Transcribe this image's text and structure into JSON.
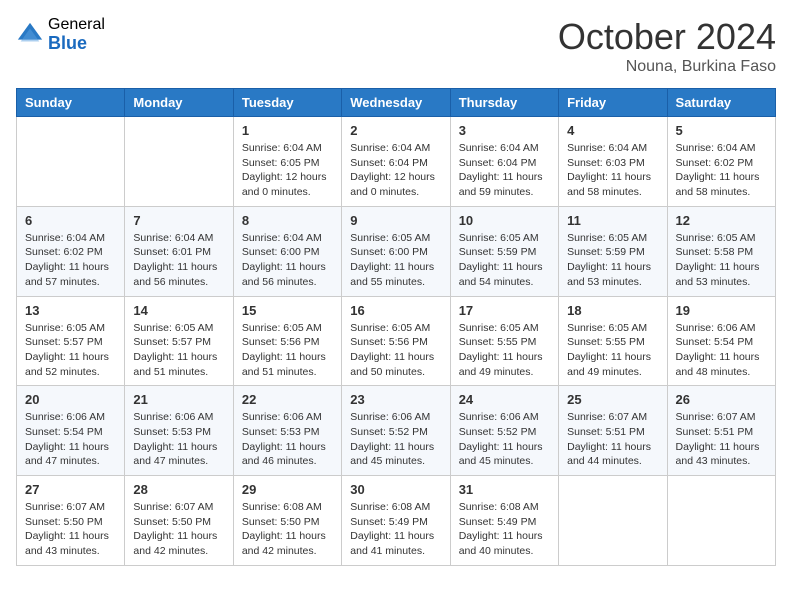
{
  "logo": {
    "general": "General",
    "blue": "Blue"
  },
  "title": "October 2024",
  "location": "Nouna, Burkina Faso",
  "days_of_week": [
    "Sunday",
    "Monday",
    "Tuesday",
    "Wednesday",
    "Thursday",
    "Friday",
    "Saturday"
  ],
  "weeks": [
    [
      null,
      null,
      {
        "day": "1",
        "sunrise": "6:04 AM",
        "sunset": "6:05 PM",
        "daylight": "12 hours and 0 minutes."
      },
      {
        "day": "2",
        "sunrise": "6:04 AM",
        "sunset": "6:04 PM",
        "daylight": "12 hours and 0 minutes."
      },
      {
        "day": "3",
        "sunrise": "6:04 AM",
        "sunset": "6:04 PM",
        "daylight": "11 hours and 59 minutes."
      },
      {
        "day": "4",
        "sunrise": "6:04 AM",
        "sunset": "6:03 PM",
        "daylight": "11 hours and 58 minutes."
      },
      {
        "day": "5",
        "sunrise": "6:04 AM",
        "sunset": "6:02 PM",
        "daylight": "11 hours and 58 minutes."
      }
    ],
    [
      {
        "day": "6",
        "sunrise": "6:04 AM",
        "sunset": "6:02 PM",
        "daylight": "11 hours and 57 minutes."
      },
      {
        "day": "7",
        "sunrise": "6:04 AM",
        "sunset": "6:01 PM",
        "daylight": "11 hours and 56 minutes."
      },
      {
        "day": "8",
        "sunrise": "6:04 AM",
        "sunset": "6:00 PM",
        "daylight": "11 hours and 56 minutes."
      },
      {
        "day": "9",
        "sunrise": "6:05 AM",
        "sunset": "6:00 PM",
        "daylight": "11 hours and 55 minutes."
      },
      {
        "day": "10",
        "sunrise": "6:05 AM",
        "sunset": "5:59 PM",
        "daylight": "11 hours and 54 minutes."
      },
      {
        "day": "11",
        "sunrise": "6:05 AM",
        "sunset": "5:59 PM",
        "daylight": "11 hours and 53 minutes."
      },
      {
        "day": "12",
        "sunrise": "6:05 AM",
        "sunset": "5:58 PM",
        "daylight": "11 hours and 53 minutes."
      }
    ],
    [
      {
        "day": "13",
        "sunrise": "6:05 AM",
        "sunset": "5:57 PM",
        "daylight": "11 hours and 52 minutes."
      },
      {
        "day": "14",
        "sunrise": "6:05 AM",
        "sunset": "5:57 PM",
        "daylight": "11 hours and 51 minutes."
      },
      {
        "day": "15",
        "sunrise": "6:05 AM",
        "sunset": "5:56 PM",
        "daylight": "11 hours and 51 minutes."
      },
      {
        "day": "16",
        "sunrise": "6:05 AM",
        "sunset": "5:56 PM",
        "daylight": "11 hours and 50 minutes."
      },
      {
        "day": "17",
        "sunrise": "6:05 AM",
        "sunset": "5:55 PM",
        "daylight": "11 hours and 49 minutes."
      },
      {
        "day": "18",
        "sunrise": "6:05 AM",
        "sunset": "5:55 PM",
        "daylight": "11 hours and 49 minutes."
      },
      {
        "day": "19",
        "sunrise": "6:06 AM",
        "sunset": "5:54 PM",
        "daylight": "11 hours and 48 minutes."
      }
    ],
    [
      {
        "day": "20",
        "sunrise": "6:06 AM",
        "sunset": "5:54 PM",
        "daylight": "11 hours and 47 minutes."
      },
      {
        "day": "21",
        "sunrise": "6:06 AM",
        "sunset": "5:53 PM",
        "daylight": "11 hours and 47 minutes."
      },
      {
        "day": "22",
        "sunrise": "6:06 AM",
        "sunset": "5:53 PM",
        "daylight": "11 hours and 46 minutes."
      },
      {
        "day": "23",
        "sunrise": "6:06 AM",
        "sunset": "5:52 PM",
        "daylight": "11 hours and 45 minutes."
      },
      {
        "day": "24",
        "sunrise": "6:06 AM",
        "sunset": "5:52 PM",
        "daylight": "11 hours and 45 minutes."
      },
      {
        "day": "25",
        "sunrise": "6:07 AM",
        "sunset": "5:51 PM",
        "daylight": "11 hours and 44 minutes."
      },
      {
        "day": "26",
        "sunrise": "6:07 AM",
        "sunset": "5:51 PM",
        "daylight": "11 hours and 43 minutes."
      }
    ],
    [
      {
        "day": "27",
        "sunrise": "6:07 AM",
        "sunset": "5:50 PM",
        "daylight": "11 hours and 43 minutes."
      },
      {
        "day": "28",
        "sunrise": "6:07 AM",
        "sunset": "5:50 PM",
        "daylight": "11 hours and 42 minutes."
      },
      {
        "day": "29",
        "sunrise": "6:08 AM",
        "sunset": "5:50 PM",
        "daylight": "11 hours and 42 minutes."
      },
      {
        "day": "30",
        "sunrise": "6:08 AM",
        "sunset": "5:49 PM",
        "daylight": "11 hours and 41 minutes."
      },
      {
        "day": "31",
        "sunrise": "6:08 AM",
        "sunset": "5:49 PM",
        "daylight": "11 hours and 40 minutes."
      },
      null,
      null
    ]
  ]
}
